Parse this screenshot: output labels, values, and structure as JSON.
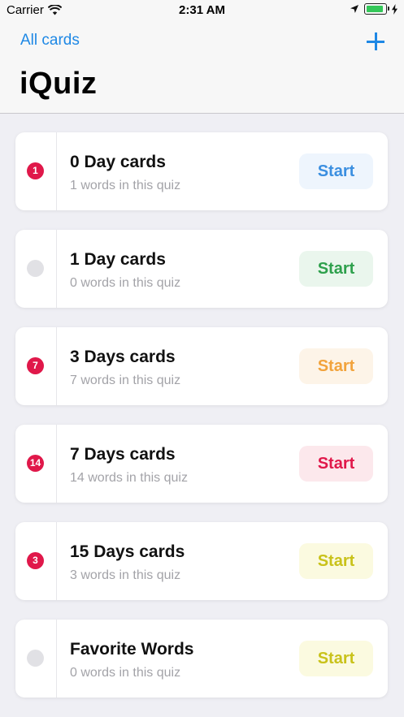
{
  "status_bar": {
    "carrier": "Carrier",
    "time": "2:31 AM"
  },
  "nav": {
    "back_label": "All cards",
    "title": "iQuiz"
  },
  "cards": [
    {
      "title": "0 Day cards",
      "subtitle": "1 words in this quiz",
      "badge": "1",
      "start_label": "Start",
      "accent": "#3b8fe0",
      "accent_bg": "#eef5fd"
    },
    {
      "title": "1 Day cards",
      "subtitle": "0 words in this quiz",
      "badge": "",
      "start_label": "Start",
      "accent": "#2ea04c",
      "accent_bg": "#eaf6ed"
    },
    {
      "title": "3 Days cards",
      "subtitle": "7 words in this quiz",
      "badge": "7",
      "start_label": "Start",
      "accent": "#f2a33c",
      "accent_bg": "#fdf4e8"
    },
    {
      "title": "7 Days cards",
      "subtitle": "14 words in this quiz",
      "badge": "14",
      "start_label": "Start",
      "accent": "#e0184a",
      "accent_bg": "#fce8ec"
    },
    {
      "title": "15 Days cards",
      "subtitle": "3 words in this quiz",
      "badge": "3",
      "start_label": "Start",
      "accent": "#c9c21a",
      "accent_bg": "#fbfae0"
    },
    {
      "title": "Favorite Words",
      "subtitle": "0 words in this quiz",
      "badge": "",
      "start_label": "Start",
      "accent": "#c9c21a",
      "accent_bg": "#fbfae0"
    }
  ],
  "colors": {
    "tint": "#1e88e5",
    "badge": "#e0184a",
    "battery": "#34c759"
  },
  "icons": {
    "wifi": "wifi-icon",
    "location": "location-arrow-icon",
    "battery": "battery-icon",
    "charging": "charging-bolt-icon",
    "add": "plus-icon"
  }
}
